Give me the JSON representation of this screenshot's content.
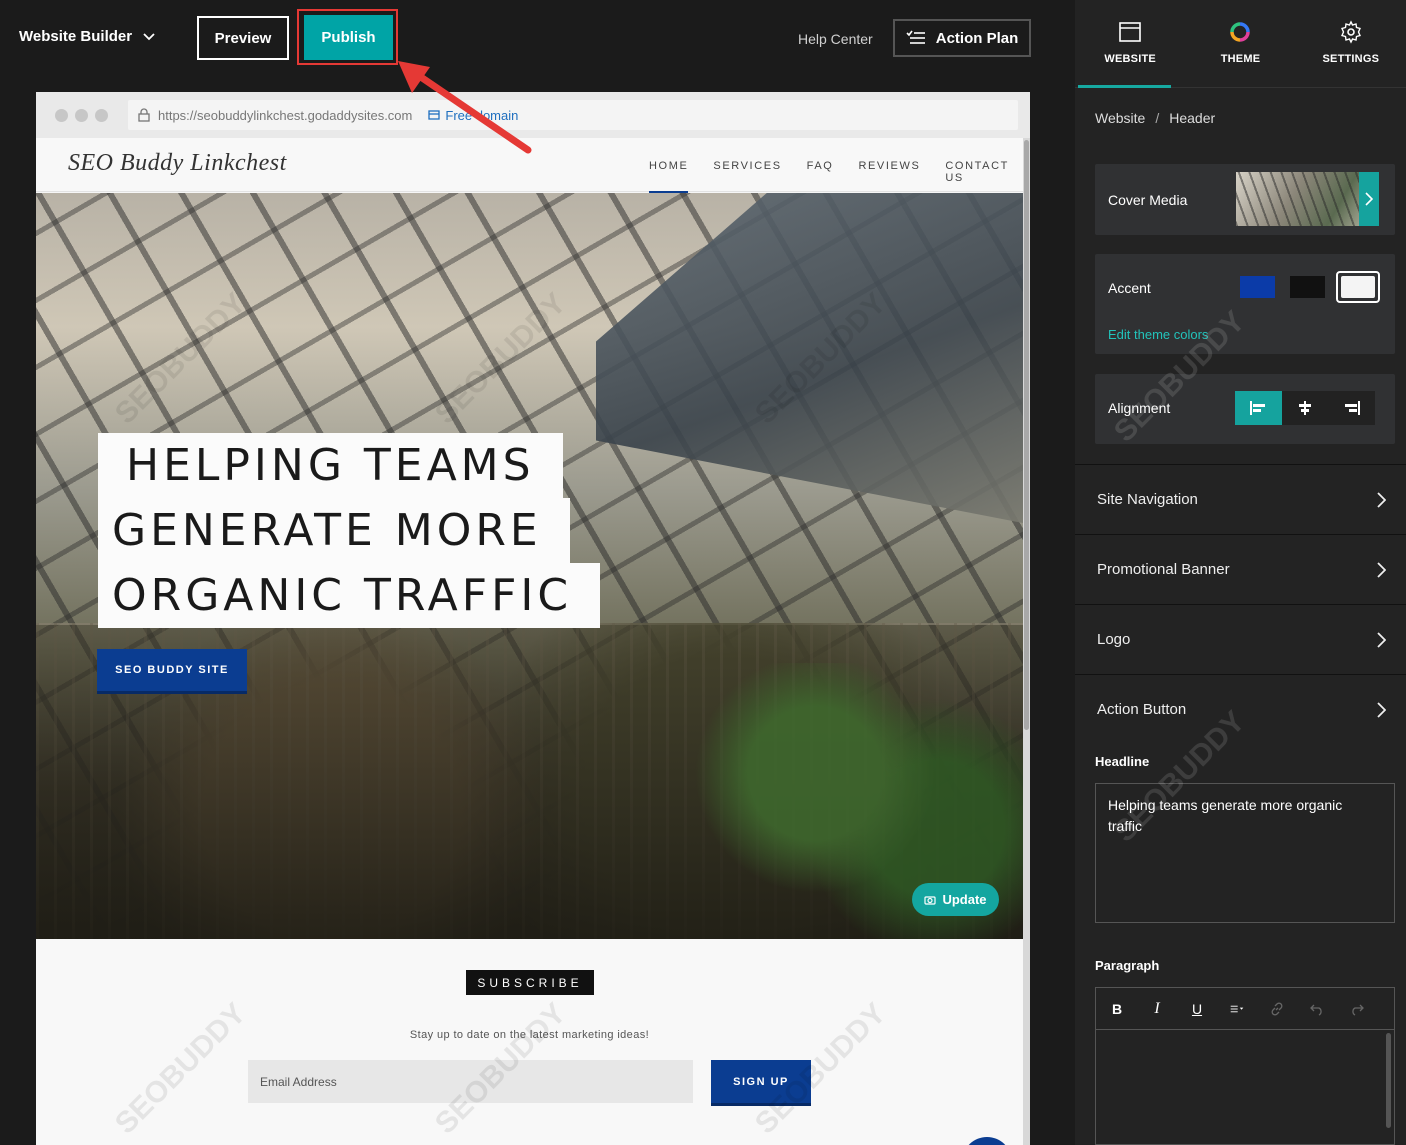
{
  "topbar": {
    "brand_label": "Website Builder",
    "preview_label": "Preview",
    "publish_label": "Publish",
    "help_center_label": "Help Center",
    "action_plan_label": "Action Plan"
  },
  "browser": {
    "url": "https://seobuddylinkchest.godaddysites.com",
    "domain_link": "Free domain"
  },
  "site": {
    "logo": "SEO Buddy Linkchest",
    "nav": [
      "HOME",
      "SERVICES",
      "FAQ",
      "REVIEWS",
      "CONTACT US"
    ],
    "active_nav": "HOME",
    "headline_lines": [
      "HELPING TEAMS",
      "GENERATE MORE",
      "ORGANIC TRAFFIC"
    ],
    "cta_label": "SEO BUDDY SITE",
    "update_label": "Update",
    "subscribe": {
      "badge": "SUBSCRIBE",
      "text": "Stay up to date on the latest marketing ideas!",
      "email_placeholder": "Email Address",
      "signup_label": "SIGN UP"
    }
  },
  "panel": {
    "tabs": [
      {
        "label": "WEBSITE",
        "icon": "browser-window-icon",
        "active": true
      },
      {
        "label": "THEME",
        "icon": "color-wheel-icon",
        "active": false
      },
      {
        "label": "SETTINGS",
        "icon": "gear-icon",
        "active": false
      }
    ],
    "breadcrumb": {
      "root": "Website",
      "sep": "/",
      "current": "Header"
    },
    "cover_media_label": "Cover Media",
    "accent_label": "Accent",
    "accent_colors": [
      "#0b3ba8",
      "#111111",
      "#f4f4f4"
    ],
    "edit_theme_colors": "Edit theme colors",
    "alignment_label": "Alignment",
    "alignment_selected": "left",
    "sections": [
      "Site Navigation",
      "Promotional Banner",
      "Logo",
      "Action Button"
    ],
    "headline_label": "Headline",
    "headline_value": "Helping teams generate more organic traffic",
    "paragraph_label": "Paragraph",
    "paragraph_toolbar": [
      "B",
      "I",
      "U"
    ]
  },
  "watermark": "SEOBUDDY",
  "colors": {
    "publish": "#00a4a6",
    "teal_accent": "#16a9a1",
    "brand_blue": "#0b3d91",
    "highlight_red": "#e53935"
  }
}
